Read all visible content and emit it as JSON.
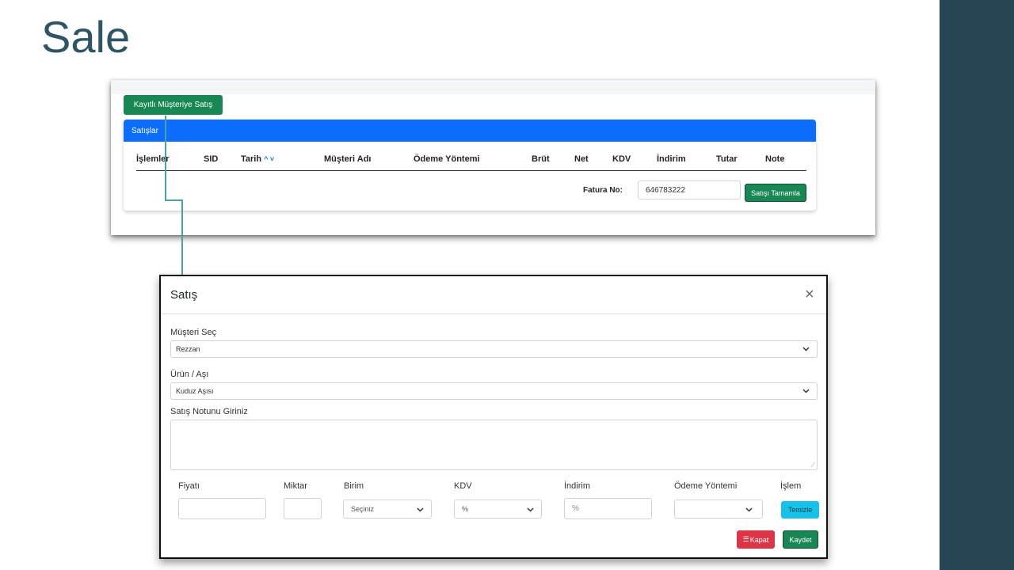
{
  "slide": {
    "title": "Sale"
  },
  "sales_list": {
    "registered_sale_button": "Kayıtlı Müşteriye Satış",
    "card_title": "Satışlar",
    "columns": [
      "İşlemler",
      "SID",
      "Tarih",
      "Müşteri Adı",
      "Ödeme Yöntemi",
      "Brüt",
      "Net",
      "KDV",
      "İndirim",
      "Tutar",
      "Note"
    ],
    "sort_icons": "^ ˅",
    "invoice_label": "Fatura No:",
    "invoice_value": "646783222",
    "complete_button": "Satışı Tamamla"
  },
  "modal": {
    "title": "Satış",
    "close": "×",
    "customer_label": "Müşteri Seç",
    "customer_value": "Rezzan",
    "product_label": "Ürün / Aşı",
    "product_value": "Kuduz Aşısı",
    "note_label": "Satış Notunu Giriniz",
    "note_value": "",
    "price_label": "Fiyatı",
    "price_value": "",
    "quantity_label": "Miktar",
    "quantity_value": "",
    "unit_label": "Birim",
    "unit_value": "Seçiniz",
    "vat_label": "KDV",
    "vat_value": "%",
    "discount_label": "İndirim",
    "discount_placeholder": "%",
    "payment_label": "Ödeme Yöntemi",
    "payment_value": "",
    "action_label": "İşlem",
    "clear_button": "Temizle",
    "close_button": "Kapat",
    "save_button": "Kaydet"
  },
  "colors": {
    "title": "#2f5565",
    "side_bar": "#264653",
    "primary": "#0d6efd",
    "success": "#198754",
    "danger": "#dc3545",
    "info": "#17c2e8",
    "connector": "#4aa3a0"
  }
}
